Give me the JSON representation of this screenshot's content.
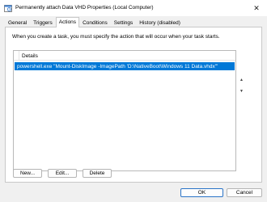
{
  "window": {
    "title": "Permanently attach Data VHD Properties (Local Computer)",
    "close_glyph": "✕"
  },
  "tabs": [
    {
      "label": "General",
      "active": false
    },
    {
      "label": "Triggers",
      "active": false
    },
    {
      "label": "Actions",
      "active": true
    },
    {
      "label": "Conditions",
      "active": false
    },
    {
      "label": "Settings",
      "active": false
    },
    {
      "label": "History (disabled)",
      "active": false
    }
  ],
  "actions": {
    "description": "When you create a task, you must specify the action that will occur when your task starts.",
    "list_header": "Details",
    "rows": [
      {
        "details": "powershell.exe \"Mount-DiskImage -ImagePath 'D:\\NativeBoot\\Windows 11 Data.vhdx'\"",
        "selected": true
      }
    ],
    "move_up_glyph": "▲",
    "move_down_glyph": "▼",
    "new_label": "New...",
    "edit_label": "Edit...",
    "delete_label": "Delete"
  },
  "footer": {
    "ok_label": "OK",
    "cancel_label": "Cancel"
  },
  "colors": {
    "selection": "#0078d7",
    "primary_border": "#2b74c7"
  },
  "icons": {
    "app": "task-scheduler-icon",
    "close": "close-icon",
    "up": "move-up-icon",
    "down": "move-down-icon"
  }
}
